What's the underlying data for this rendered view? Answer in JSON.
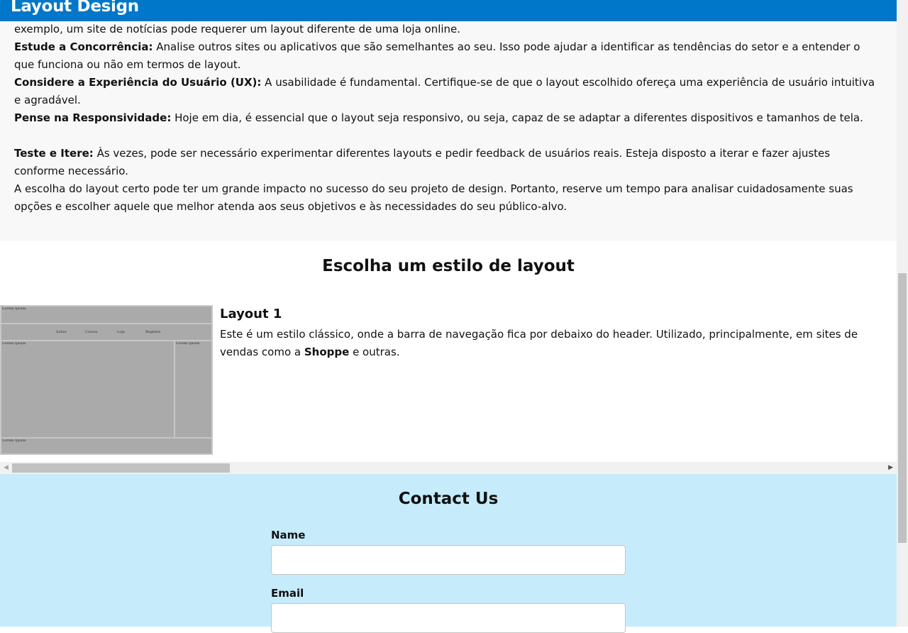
{
  "header": {
    "title": "Layout Design"
  },
  "article": {
    "paragraphs": [
      {
        "bold": "",
        "text": "exemplo, um site de notícias pode requerer um layout diferente de uma loja online."
      },
      {
        "bold": "Estude a Concorrência:",
        "text": " Analise outros sites ou aplicativos que são semelhantes ao seu. Isso pode ajudar a identificar as tendências do setor e a entender o que funciona ou não em termos de layout."
      },
      {
        "bold": "Considere a Experiência do Usuário (UX):",
        "text": " A usabilidade é fundamental. Certifique-se de que o layout escolhido ofereça uma experiência de usuário intuitiva e agradável."
      },
      {
        "bold": "Pense na Responsividade:",
        "text": " Hoje em dia, é essencial que o layout seja responsivo, ou seja, capaz de se adaptar a diferentes dispositivos e tamanhos de tela."
      },
      {
        "bold": "Teste e Itere:",
        "text": " Às vezes, pode ser necessário experimentar diferentes layouts e pedir feedback de usuários reais. Esteja disposto a iterar e fazer ajustes conforme necessário."
      },
      {
        "bold": "",
        "text": "A escolha do layout certo pode ter um grande impacto no sucesso do seu projeto de design. Portanto, reserve um tempo para analisar cuidadosamente suas opções e escolher aquele que melhor atenda aos seus objetivos e às necessidades do seu público-alvo."
      }
    ]
  },
  "layouts": {
    "heading": "Escolha um estilo de layout",
    "thumb": {
      "lorem": "Lorem ipsum",
      "nav": [
        "Sobre",
        "Cursos",
        "Loja",
        "Registre"
      ]
    },
    "card": {
      "title": "Layout 1",
      "desc_before": "Este é um estilo clássico, onde a barra de navegação fica por debaixo do header. Utilizado, principalmente, em sites de vendas como a ",
      "desc_bold": "Shoppe",
      "desc_after": " e outras."
    }
  },
  "contact": {
    "heading": "Contact Us",
    "name_label": "Name",
    "email_label": "Email",
    "name_value": "",
    "email_value": ""
  },
  "icons": {
    "scroll_left": "triangle-left-icon",
    "scroll_right": "triangle-right-icon"
  },
  "colors": {
    "header": "#0077c8",
    "contact_bg": "#c6ecfc",
    "article_bg": "#f8f8f8"
  }
}
